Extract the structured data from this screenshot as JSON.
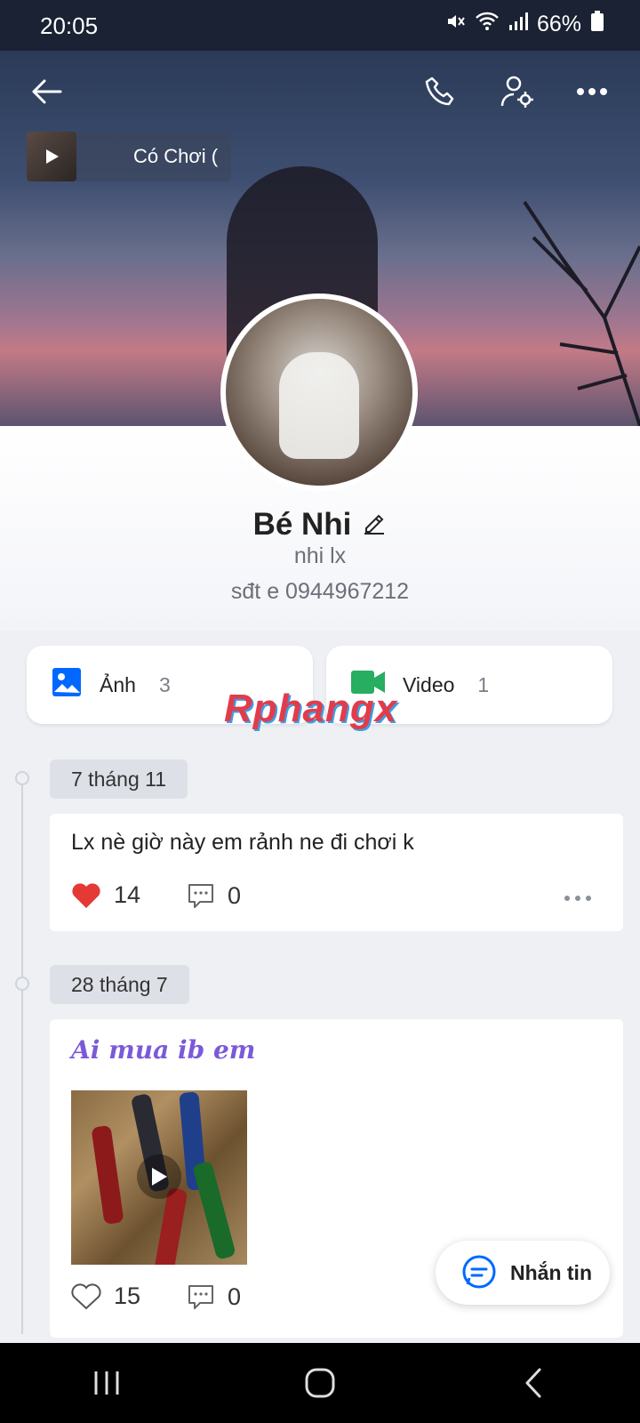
{
  "status_bar": {
    "time": "20:05",
    "battery": "66%"
  },
  "music": {
    "title": "Có Chơi ("
  },
  "profile": {
    "name": "Bé Nhi",
    "username": "nhi lx",
    "bio": "sđt e 0944967212"
  },
  "media": [
    {
      "label": "Ảnh",
      "count": "3"
    },
    {
      "label": "Video",
      "count": "1"
    }
  ],
  "watermark": "Rphangx",
  "posts": [
    {
      "date": "7 tháng 11",
      "text": "Lx nè giờ này em rảnh ne đi chơi k",
      "likes": "14",
      "comments": "0"
    },
    {
      "date": "28 tháng 7",
      "text": "Ai mua ib em",
      "likes": "15",
      "comments": "0"
    }
  ],
  "chat_button": {
    "label": "Nhắn tin"
  },
  "colors": {
    "accent": "#0068ff",
    "heart": "#e53935",
    "video": "#27ae60"
  }
}
